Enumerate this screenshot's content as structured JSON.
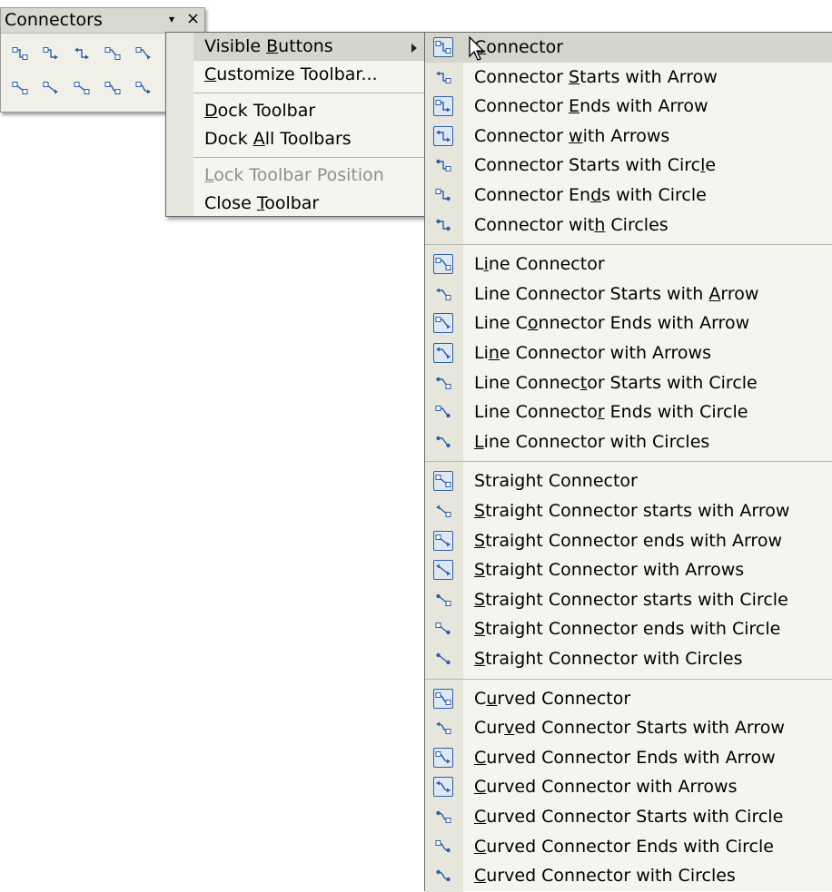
{
  "toolbar": {
    "title": "Connectors",
    "dropdown_glyph": "▾",
    "close_glyph": "×",
    "icons": [
      "connector-icon",
      "connector-ends-arrow-icon",
      "connector-with-arrows-icon",
      "line-connector-icon",
      "line-connector-ends-arrow-icon",
      "straight-connector-icon",
      "straight-connector-ends-arrow-icon",
      "straight-connector-arrows-icon",
      "curved-connector-icon",
      "curved-connector-ends-arrow-icon"
    ]
  },
  "context_menu": {
    "items": [
      {
        "pre": "Visible ",
        "u": "B",
        "post": "uttons",
        "submenu": true,
        "highlighted": true
      },
      {
        "pre": "",
        "u": "C",
        "post": "ustomize Toolbar..."
      },
      {
        "pre": "",
        "u": "D",
        "post": "ock Toolbar"
      },
      {
        "pre": "Dock ",
        "u": "A",
        "post": "ll Toolbars"
      },
      {
        "pre": "",
        "u": "L",
        "post": "ock Toolbar Position",
        "disabled": true
      },
      {
        "pre": "Close ",
        "u": "T",
        "post": "oolbar"
      }
    ]
  },
  "submenu": {
    "groups": [
      [
        {
          "pre": "",
          "u": "C",
          "post": "onnector",
          "icon": "connector-icon",
          "checked": true,
          "highlighted": true
        },
        {
          "pre": "Connector ",
          "u": "S",
          "post": "tarts with Arrow",
          "icon": "connector-starts-arrow-icon",
          "checked": false
        },
        {
          "pre": "Connector ",
          "u": "E",
          "post": "nds with Arrow",
          "icon": "connector-ends-arrow-icon",
          "checked": true
        },
        {
          "pre": "Connector ",
          "u": "w",
          "post": "ith Arrows",
          "icon": "connector-with-arrows-icon",
          "checked": true
        },
        {
          "pre": "Connector Starts with Circ",
          "u": "l",
          "post": "e",
          "icon": "connector-starts-circle-icon",
          "checked": false
        },
        {
          "pre": "Connector En",
          "u": "d",
          "post": "s with Circle",
          "icon": "connector-ends-circle-icon",
          "checked": false
        },
        {
          "pre": "Connector wit",
          "u": "h",
          "post": " Circles",
          "icon": "connector-with-circles-icon",
          "checked": false
        }
      ],
      [
        {
          "pre": "L",
          "u": "i",
          "post": "ne Connector",
          "icon": "line-connector-icon",
          "checked": true
        },
        {
          "pre": "Line Connector Starts with ",
          "u": "A",
          "post": "rrow",
          "icon": "line-connector-starts-arrow-icon",
          "checked": false
        },
        {
          "pre": "Line C",
          "u": "o",
          "post": "nnector Ends with Arrow",
          "icon": "line-connector-ends-arrow-icon",
          "checked": true
        },
        {
          "pre": "Li",
          "u": "n",
          "post": "e Connector with Arrows",
          "icon": "line-connector-with-arrows-icon",
          "checked": true
        },
        {
          "pre": "Line Connec",
          "u": "t",
          "post": "or Starts with Circle",
          "icon": "line-connector-starts-circle-icon",
          "checked": false
        },
        {
          "pre": "Line Connecto",
          "u": "r",
          "post": " Ends with Circle",
          "icon": "line-connector-ends-circle-icon",
          "checked": false
        },
        {
          "pre": "",
          "u": "L",
          "post": "ine Connector with Circles",
          "icon": "line-connector-with-circles-icon",
          "checked": false
        }
      ],
      [
        {
          "pre": "Strai",
          "u": "g",
          "post": "ht Connector",
          "icon": "straight-connector-icon",
          "checked": true
        },
        {
          "pre": "",
          "u": "S",
          "post": "traight Connector starts with Arrow",
          "icon": "straight-connector-starts-arrow-icon",
          "checked": false
        },
        {
          "pre": "",
          "u": "S",
          "post": "traight Connector ends with Arrow",
          "icon": "straight-connector-ends-arrow-icon",
          "checked": true
        },
        {
          "pre": "",
          "u": "S",
          "post": "traight Connector with Arrows",
          "icon": "straight-connector-with-arrows-icon",
          "checked": true
        },
        {
          "pre": "",
          "u": "S",
          "post": "traight Connector starts with Circle",
          "icon": "straight-connector-starts-circle-icon",
          "checked": false
        },
        {
          "pre": "",
          "u": "S",
          "post": "traight Connector ends with Circle",
          "icon": "straight-connector-ends-circle-icon",
          "checked": false
        },
        {
          "pre": "",
          "u": "S",
          "post": "traight Connector with Circles",
          "icon": "straight-connector-with-circles-icon",
          "checked": false
        }
      ],
      [
        {
          "pre": "C",
          "u": "u",
          "post": "rved Connector",
          "icon": "curved-connector-icon",
          "checked": true
        },
        {
          "pre": "Cur",
          "u": "v",
          "post": "ed Connector Starts with Arrow",
          "icon": "curved-connector-starts-arrow-icon",
          "checked": false
        },
        {
          "pre": "",
          "u": "C",
          "post": "urved Connector Ends with Arrow",
          "icon": "curved-connector-ends-arrow-icon",
          "checked": true
        },
        {
          "pre": "",
          "u": "C",
          "post": "urved Connector with Arrows",
          "icon": "curved-connector-with-arrows-icon",
          "checked": true
        },
        {
          "pre": "",
          "u": "C",
          "post": "urved Connector Starts with Circle",
          "icon": "curved-connector-starts-circle-icon",
          "checked": false
        },
        {
          "pre": "",
          "u": "C",
          "post": "urved Connector Ends with Circle",
          "icon": "curved-connector-ends-circle-icon",
          "checked": false
        },
        {
          "pre": "",
          "u": "C",
          "post": "urved Connector with Circles",
          "icon": "curved-connector-with-circles-icon",
          "checked": false
        }
      ]
    ]
  },
  "colors": {
    "icon_blue": "#2d5fa8",
    "menu_bg": "#f5f4ee",
    "highlight": "#d6d5cb",
    "disabled_text": "#8e8e8e"
  }
}
